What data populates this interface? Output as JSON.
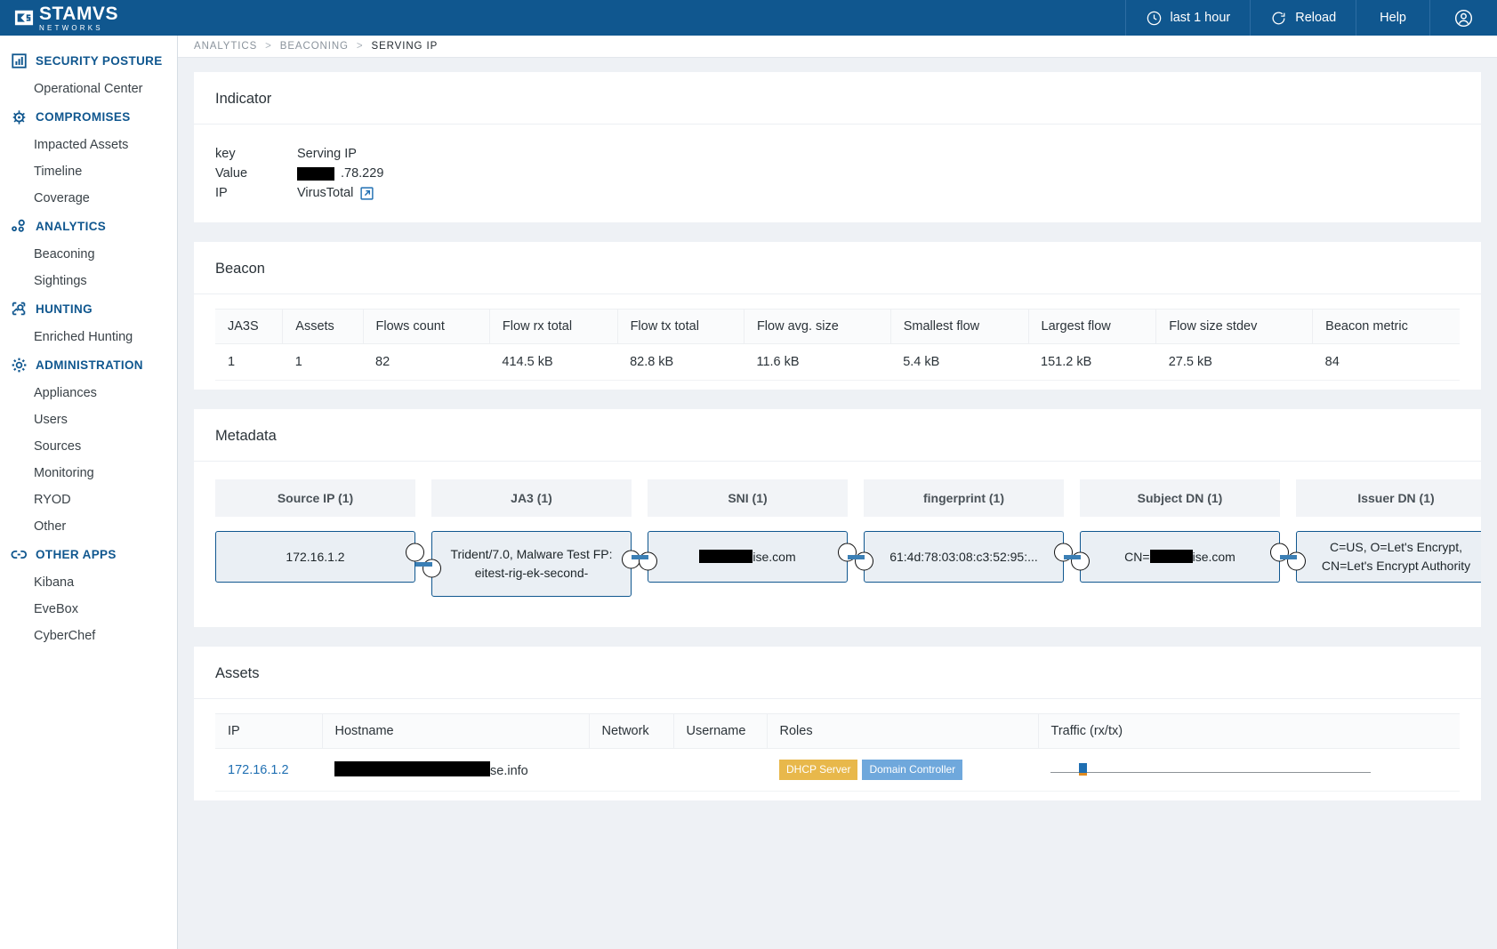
{
  "brand": {
    "name": "STAMVS",
    "subtitle": "NETWORKS",
    "accent": "#10578f"
  },
  "topbar": {
    "time_range": "last 1 hour",
    "reload": "Reload",
    "help": "Help",
    "time_icon": "clock-icon",
    "reload_icon": "refresh-icon",
    "account_icon": "user-account-icon"
  },
  "sidebar": {
    "groups": [
      {
        "label": "SECURITY POSTURE",
        "icon": "bar-chart-icon",
        "items": [
          "Operational Center"
        ]
      },
      {
        "label": "COMPROMISES",
        "icon": "bug-icon",
        "items": [
          "Impacted Assets",
          "Timeline",
          "Coverage"
        ]
      },
      {
        "label": "ANALYTICS",
        "icon": "analytics-icon",
        "items": [
          "Beaconing",
          "Sightings"
        ]
      },
      {
        "label": "HUNTING",
        "icon": "hunting-icon",
        "items": [
          "Enriched Hunting"
        ]
      },
      {
        "label": "ADMINISTRATION",
        "icon": "gear-icon",
        "items": [
          "Appliances",
          "Users",
          "Sources",
          "Monitoring",
          "RYOD",
          "Other"
        ]
      },
      {
        "label": "OTHER APPS",
        "icon": "link-icon",
        "items": [
          "Kibana",
          "EveBox",
          "CyberChef"
        ]
      }
    ]
  },
  "breadcrumb": {
    "items": [
      "ANALYTICS",
      "BEACONING",
      "SERVING IP"
    ],
    "separator": ">"
  },
  "indicator": {
    "title": "Indicator",
    "rows": [
      {
        "key": "key",
        "value": "Serving IP",
        "redacted": false
      },
      {
        "key": "Value",
        "value": ".78.229",
        "redacted": true
      },
      {
        "key": "IP",
        "value": "VirusTotal",
        "redacted": false,
        "external_link": true
      }
    ]
  },
  "beacon": {
    "title": "Beacon",
    "columns": [
      "JA3S",
      "Assets",
      "Flows count",
      "Flow rx total",
      "Flow tx total",
      "Flow avg. size",
      "Smallest flow",
      "Largest flow",
      "Flow size stdev",
      "Beacon metric"
    ],
    "rows": [
      [
        "1",
        "1",
        "82",
        "414.5 kB",
        "82.8 kB",
        "11.6 kB",
        "5.4 kB",
        "151.2 kB",
        "27.5 kB",
        "84"
      ]
    ]
  },
  "metadata": {
    "title": "Metadata",
    "columns": [
      {
        "label": "Source IP (1)",
        "node": "172.16.1.2",
        "redacted": false,
        "tall": false
      },
      {
        "label": "JA3 (1)",
        "node": "Trident/7.0, Malware Test FP: eitest-rig-ek-second-",
        "redacted": false,
        "tall": true
      },
      {
        "label": "SNI (1)",
        "node": "ise.com",
        "redacted": true,
        "tall": false
      },
      {
        "label": "fingerprint (1)",
        "node": "61:4d:78:03:08:c3:52:95:...",
        "redacted": false,
        "tall": false
      },
      {
        "label": "Subject DN (1)",
        "node": "CN=",
        "node_suffix": "ise.com",
        "redacted": true,
        "tall": false
      },
      {
        "label": "Issuer DN (1)",
        "node": "C=US, O=Let's Encrypt, CN=Let's Encrypt Authority",
        "redacted": false,
        "tall": false
      }
    ]
  },
  "assets": {
    "title": "Assets",
    "columns": [
      "IP",
      "Hostname",
      "Network",
      "Username",
      "Roles",
      "Traffic (rx/tx)"
    ],
    "rows": [
      {
        "ip": "172.16.1.2",
        "hostname_redacted": true,
        "hostname": "se.info",
        "network": "",
        "username": "",
        "roles": [
          {
            "label": "DHCP Server",
            "color": "#e8b84b"
          },
          {
            "label": "Domain Controller",
            "color": "#6fa8dc"
          }
        ],
        "traffic": {
          "rx": 1,
          "tx": 1
        }
      }
    ]
  }
}
